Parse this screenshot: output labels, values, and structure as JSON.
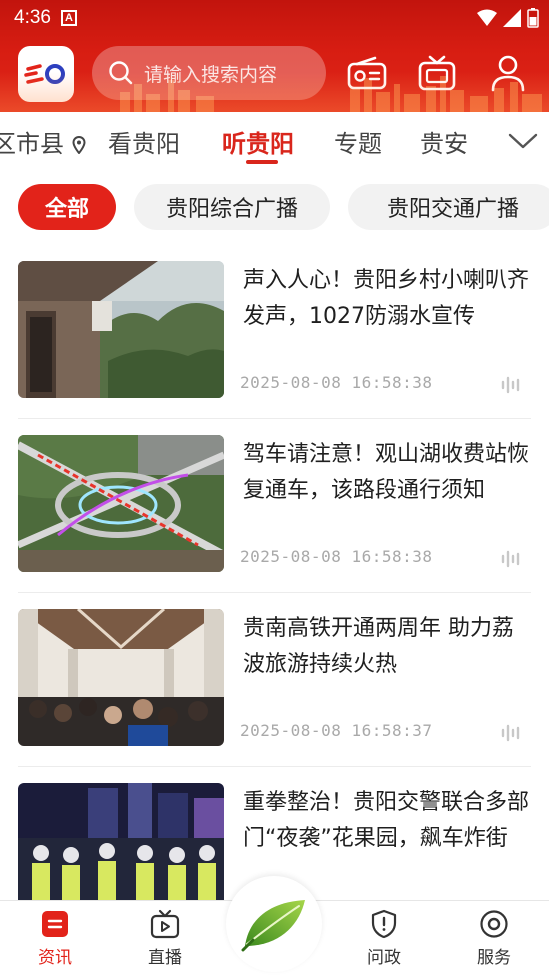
{
  "status_bar": {
    "time": "4:36",
    "notification": "A"
  },
  "header": {
    "search_placeholder": "请输入搜索内容",
    "colors": {
      "header_red": "#d71d12",
      "accent": "#e2231a"
    }
  },
  "channel_tabs": {
    "items": [
      {
        "label": "区市县"
      },
      {
        "label": "看贵阳"
      },
      {
        "label": "听贵阳",
        "active": true
      },
      {
        "label": "专题"
      },
      {
        "label": "贵安"
      }
    ]
  },
  "filter_chips": [
    {
      "label": "全部",
      "active": true
    },
    {
      "label": "贵阳综合广播"
    },
    {
      "label": "贵阳交通广播"
    }
  ],
  "news": [
    {
      "title": "声入人心！贵阳乡村小喇叭齐发声，1027防溺水宣传",
      "time": "2025-08-08 16:58:38"
    },
    {
      "title": "驾车请注意！观山湖收费站恢复通车，该路段通行须知",
      "time": "2025-08-08 16:58:38"
    },
    {
      "title": "贵南高铁开通两周年  助力荔波旅游持续火热",
      "time": "2025-08-08 16:58:37"
    },
    {
      "title": "重拳整治！贵阳交警联合多部门“夜袭”花果园，飙车炸街",
      "time": ""
    }
  ],
  "bottom_nav": [
    {
      "label": "资讯",
      "icon": "news-icon",
      "active": true
    },
    {
      "label": "直播",
      "icon": "live-tv-icon"
    },
    {
      "label": "",
      "icon": "leaf-icon"
    },
    {
      "label": "问政",
      "icon": "shield-icon"
    },
    {
      "label": "服务",
      "icon": "service-icon"
    }
  ]
}
